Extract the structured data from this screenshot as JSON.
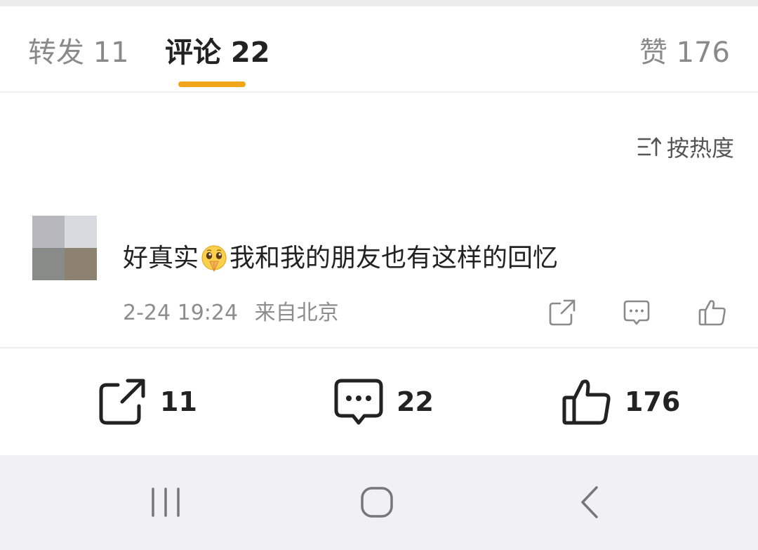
{
  "tabs": {
    "repost": "转发 11",
    "comment": "评论 22",
    "like": "赞 176"
  },
  "sort": {
    "label": "按热度",
    "icon": "sort-icon"
  },
  "comment": {
    "text_before": "好真实",
    "emoji": "pleading-hands-emoji",
    "text_after": "我和我的朋友也有这样的回忆",
    "time": "2-24 19:24",
    "location": "来自北京",
    "actions": [
      "share-icon",
      "comment-icon",
      "like-icon"
    ]
  },
  "bottom_bar": {
    "share_count": "11",
    "comment_count": "22",
    "like_count": "176"
  },
  "colors": {
    "accent": "#f0a51b",
    "muted_text": "#8a8a8a",
    "primary_text": "#222222"
  }
}
